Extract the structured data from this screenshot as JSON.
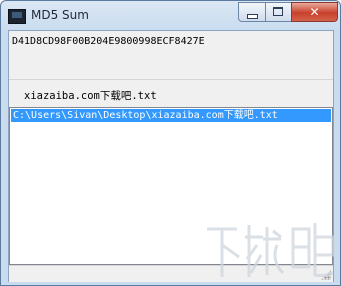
{
  "window": {
    "title": "MD5 Sum",
    "close_glyph": "✕",
    "icons": {
      "app": "app-icon",
      "minimize": "minimize-icon",
      "maximize": "maximize-icon",
      "close": "close-icon"
    }
  },
  "md5": {
    "hash": "D41D8CD98F00B204E9800998ECF8427E"
  },
  "file": {
    "name": "xiazaiba.com下载吧.txt"
  },
  "list": {
    "items": [
      {
        "path": "C:\\Users\\Sivan\\Desktop\\xiazaiba.com下载吧.txt",
        "selected": true
      }
    ]
  },
  "colors": {
    "selection": "#3399ff",
    "title_bar": "#c9dcef",
    "close_button": "#c8402c"
  }
}
